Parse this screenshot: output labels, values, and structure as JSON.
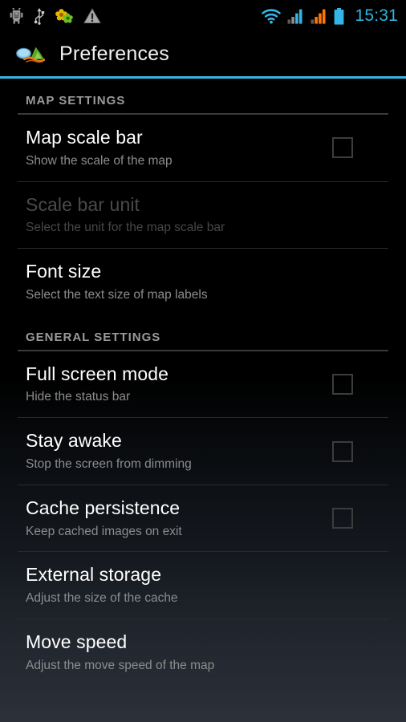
{
  "status_bar": {
    "icons": [
      "android-debug-icon",
      "usb-icon",
      "sync-flowers-icon",
      "warning-triangle-icon"
    ],
    "right_icons": [
      "wifi-icon",
      "signal-bars-blue-icon",
      "signal-bars-orange-icon",
      "battery-icon"
    ],
    "time": "15:31",
    "accent_color": "#33b5e5",
    "signal_secondary_color": "#ff7700"
  },
  "action_bar": {
    "icon": "map-app-icon",
    "title": "Preferences",
    "accent_color": "#33b5e5"
  },
  "sections": [
    {
      "header": "MAP SETTINGS",
      "items": [
        {
          "title": "Map scale bar",
          "summary": "Show the scale of the map",
          "widget": "checkbox",
          "checked": false,
          "enabled": true
        },
        {
          "title": "Scale bar unit",
          "summary": "Select the unit for the map scale bar",
          "widget": "none",
          "checked": false,
          "enabled": false
        },
        {
          "title": "Font size",
          "summary": "Select the text size of map labels",
          "widget": "none",
          "checked": false,
          "enabled": true
        }
      ]
    },
    {
      "header": "GENERAL SETTINGS",
      "items": [
        {
          "title": "Full screen mode",
          "summary": "Hide the status bar",
          "widget": "checkbox",
          "checked": false,
          "enabled": true
        },
        {
          "title": "Stay awake",
          "summary": "Stop the screen from dimming",
          "widget": "checkbox",
          "checked": false,
          "enabled": true
        },
        {
          "title": "Cache persistence",
          "summary": "Keep cached images on exit",
          "widget": "checkbox",
          "checked": false,
          "enabled": true
        },
        {
          "title": "External storage",
          "summary": "Adjust the size of the cache",
          "widget": "none",
          "checked": false,
          "enabled": true
        },
        {
          "title": "Move speed",
          "summary": "Adjust the move speed of the map",
          "widget": "none",
          "checked": false,
          "enabled": true
        }
      ]
    }
  ]
}
